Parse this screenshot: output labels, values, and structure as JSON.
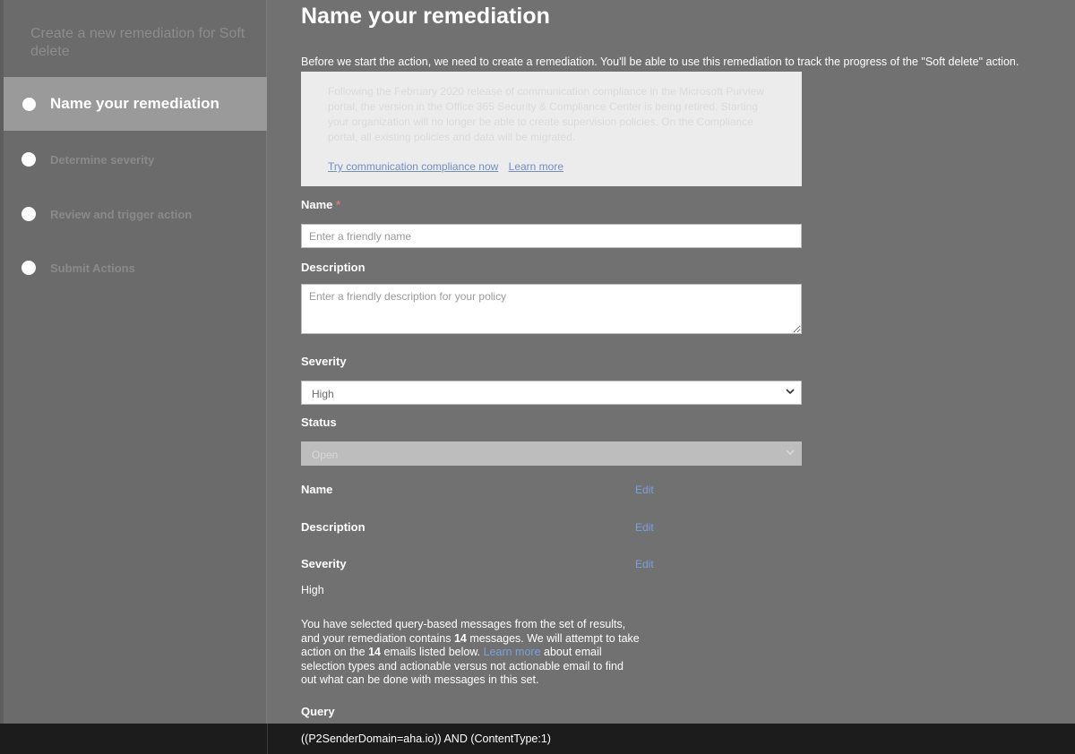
{
  "sidebar": {
    "title": "Create a new remediation for Soft delete",
    "steps": [
      {
        "label": "Name your remediation",
        "active": true
      },
      {
        "label": "Determine severity",
        "active": false
      },
      {
        "label": "Review and trigger action",
        "active": false
      },
      {
        "label": "Submit Actions",
        "active": false
      }
    ]
  },
  "main": {
    "title": "Name your remediation",
    "intro": "Before we start the action, we need to create a remediation. You'll be able to use this remediation to track the progress of the \"Soft delete\" action.",
    "notice": {
      "text": "Following the February 2020 release of communication compliance in the Microsoft Purview portal, the version in the Office 365 Security & Compliance Center is being retired. Starting your organization will no longer be able to create supervision policies. On the Compliance portal, all existing policies and data will be migrated.",
      "link_try": "Try communication compliance now",
      "link_learn": "Learn more"
    },
    "name_field": {
      "label": "Name",
      "required_mark": "*",
      "placeholder": "Enter a friendly name",
      "value": ""
    },
    "description_field": {
      "label": "Description",
      "placeholder": "Enter a friendly description for your policy",
      "value": ""
    },
    "severity_field": {
      "label": "Severity",
      "value": "High"
    },
    "status_field": {
      "label": "Status",
      "value": "Open"
    },
    "summary": {
      "name_label": "Name",
      "description_label": "Description",
      "severity_label": "Severity",
      "severity_value": "High",
      "edit_label": "Edit"
    },
    "paragraph": {
      "part1": "You have selected query-based messages from the set of results, and your remediation contains ",
      "count1": "14",
      "part2": " messages. We will attempt to take action on the ",
      "count2": "14",
      "part3": " emails listed below. ",
      "link": "Learn more",
      "part4": " about email selection types and actionable versus not actionable email to find out what can be done with messages in this set."
    },
    "query_label": "Query",
    "query_value": "((P2SenderDomain=aha.io)) AND (ContentType:1)"
  }
}
